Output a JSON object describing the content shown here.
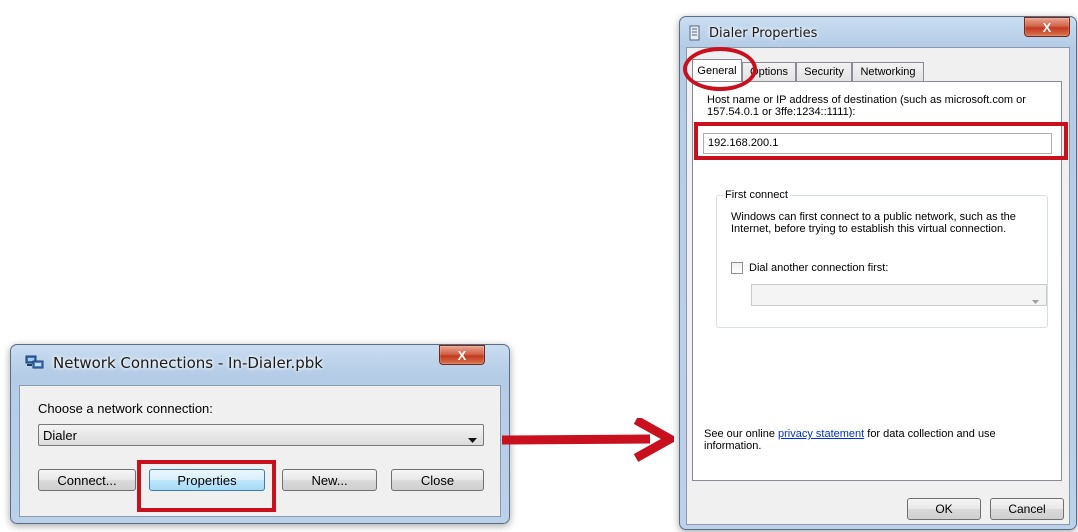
{
  "network_dialog": {
    "title": "Network Connections - In-Dialer.pbk",
    "close_label": "X",
    "prompt": "Choose a network connection:",
    "selected_connection": "Dialer",
    "buttons": {
      "connect": "Connect...",
      "properties": "Properties",
      "new": "New...",
      "close": "Close"
    }
  },
  "properties_dialog": {
    "title": "Dialer Properties",
    "close_label": "X",
    "tabs": [
      "General",
      "Options",
      "Security",
      "Networking"
    ],
    "host_label": "Host name or IP address of destination (such as microsoft.com or 157.54.0.1 or 3ffe:1234::1111):",
    "host_value": "192.168.200.1",
    "first_connect": {
      "legend": "First connect",
      "description": "Windows can first connect to a public network, such as the Internet, before trying to establish this virtual connection.",
      "checkbox_label": "Dial another connection first:",
      "dropdown_value": ""
    },
    "privacy_prefix": "See our online ",
    "privacy_link": "privacy statement",
    "privacy_suffix": " for data collection and use information.",
    "buttons": {
      "ok": "OK",
      "cancel": "Cancel"
    }
  },
  "colors": {
    "highlight": "#c8101e",
    "arrow": "#c8101e",
    "link": "#0033cc"
  }
}
